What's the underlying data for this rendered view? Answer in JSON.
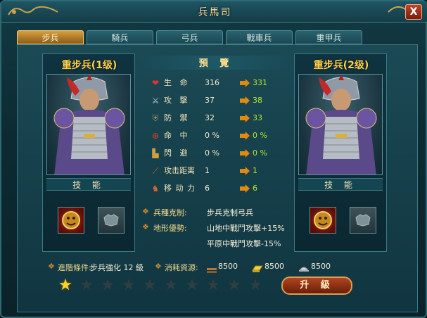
{
  "window": {
    "title": "兵馬司",
    "close_label": "X"
  },
  "tabs": [
    {
      "label": "步兵",
      "active": true
    },
    {
      "label": "騎兵",
      "active": false
    },
    {
      "label": "弓兵",
      "active": false
    },
    {
      "label": "戰車兵",
      "active": false
    },
    {
      "label": "重甲兵",
      "active": false
    }
  ],
  "left_card": {
    "name": "重步兵(1级)",
    "skill_label": "技 能"
  },
  "right_card": {
    "name": "重步兵(2级)",
    "skill_label": "技 能"
  },
  "preview": {
    "title": "預 覽",
    "stats": [
      {
        "icon": "heart-icon",
        "label": "生 命",
        "current": "316",
        "next": "331"
      },
      {
        "icon": "sword-icon",
        "label": "攻 擊",
        "current": "37",
        "next": "38"
      },
      {
        "icon": "shield-icon",
        "label": "防 禦",
        "current": "32",
        "next": "33"
      },
      {
        "icon": "target-icon",
        "label": "命 中",
        "current": "0 %",
        "next": "0 %"
      },
      {
        "icon": "boot-icon",
        "label": "閃 避",
        "current": "0 %",
        "next": "0 %"
      },
      {
        "icon": "spear-icon",
        "label": "攻击距离",
        "current": "1",
        "next": "1"
      },
      {
        "icon": "horse-icon",
        "label": "移 动 力",
        "current": "6",
        "next": "6"
      }
    ],
    "counter_label": "兵種克制:",
    "counter_value": "步兵克制弓兵",
    "terrain_label": "地形優勢:",
    "terrain_values": [
      "山地中戰鬥攻擊+15%",
      "平原中戰鬥攻擊-15%"
    ]
  },
  "upgrade_req": {
    "label": "進階條件:",
    "value": "步兵強化 12 級"
  },
  "cost": {
    "label": "消耗資源:",
    "items": [
      {
        "icon": "wood-icon",
        "value": "8500"
      },
      {
        "icon": "gold-icon",
        "value": "8500"
      },
      {
        "icon": "silver-icon",
        "value": "8500"
      }
    ]
  },
  "stars": {
    "filled": 1,
    "total": 10
  },
  "upgrade_button": "升 級",
  "colors": {
    "accent": "#ffd34a",
    "next_value": "#b8e62a",
    "arrow": "#e08a10"
  }
}
